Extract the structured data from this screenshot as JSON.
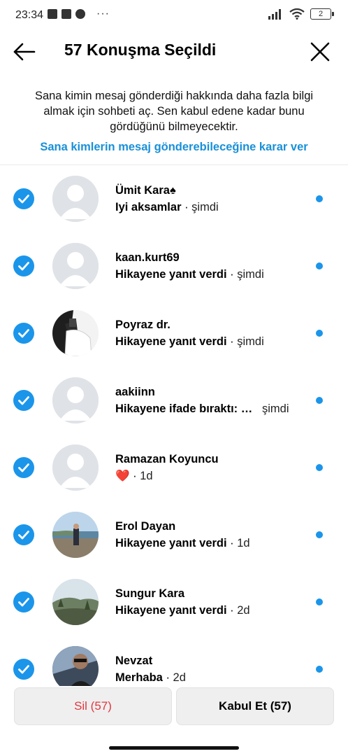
{
  "status_bar": {
    "time": "23:34",
    "battery": "2"
  },
  "header": {
    "title": "57 Konuşma Seçildi"
  },
  "info": {
    "text": "Sana kimin mesaj gönderdiği hakkında daha fazla bilgi almak için sohbeti aç. Sen kabul edene kadar bunu gördüğünü bilmeyecektir.",
    "link": "Sana kimlerin mesaj gönderebileceğine karar ver"
  },
  "conversations": [
    {
      "name": "Ümit Kara♠",
      "message": "Iyi aksamlar",
      "sep": " · ",
      "time": "şimdi",
      "avatar": "default-avatar",
      "selected": true,
      "unread": true
    },
    {
      "name": "kaan.kurt69",
      "message": "Hikayene yanıt verdi",
      "sep": " · ",
      "time": "şimdi",
      "avatar": "default-avatar",
      "selected": true,
      "unread": true
    },
    {
      "name": "Poyraz dr.",
      "message": "Hikayene yanıt verdi",
      "sep": " · ",
      "time": "şimdi",
      "avatar": "photo-person-white-shirt",
      "selected": true,
      "unread": true
    },
    {
      "name": "aakiinn",
      "message": "Hikayene ifade bıraktı: …",
      "sep": "   ",
      "time": "şimdi",
      "avatar": "default-avatar",
      "selected": true,
      "unread": true
    },
    {
      "name": "Ramazan Koyuncu",
      "message": "❤️",
      "sep": " · ",
      "time": "1d",
      "avatar": "default-avatar",
      "selected": true,
      "unread": true
    },
    {
      "name": "Erol Dayan",
      "message": "Hikayene yanıt verdi",
      "sep": " · ",
      "time": "1d",
      "avatar": "photo-person-seaside",
      "selected": true,
      "unread": true
    },
    {
      "name": "Sungur Kara",
      "message": "Hikayene yanıt verdi",
      "sep": " · ",
      "time": "2d",
      "avatar": "photo-landscape-hills",
      "selected": true,
      "unread": true
    },
    {
      "name": "Nevzat",
      "message": "Merhaba",
      "sep": " · ",
      "time": "2d",
      "avatar": "photo-person-sunglasses",
      "selected": true,
      "unread": true
    }
  ],
  "actions": {
    "delete_label": "Sil (57)",
    "accept_label": "Kabul Et (57)"
  },
  "colors": {
    "accent": "#1b95ea",
    "link": "#1990d8",
    "danger": "#e0383f"
  }
}
